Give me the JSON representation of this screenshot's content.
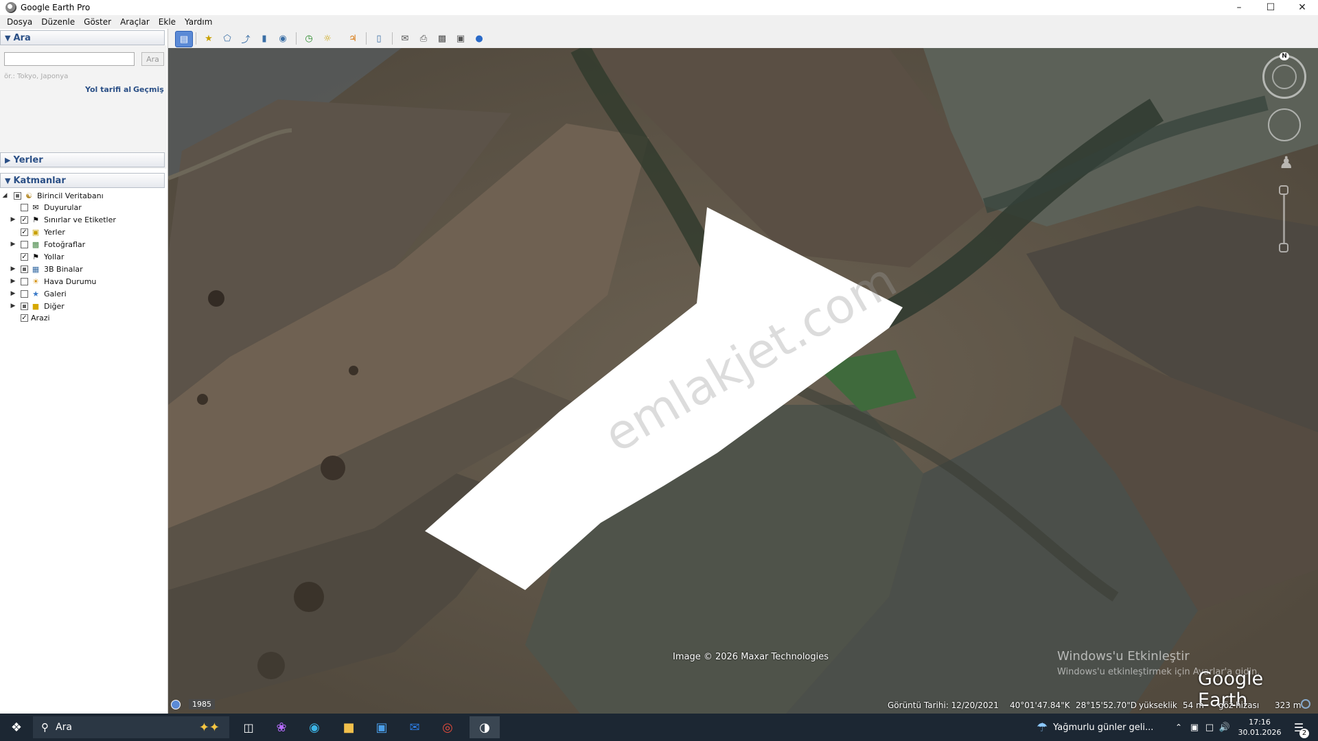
{
  "window": {
    "title": "Google Earth Pro"
  },
  "menu": [
    "Dosya",
    "Düzenle",
    "Göster",
    "Araçlar",
    "Ekle",
    "Yardım"
  ],
  "search": {
    "header": "Ara",
    "placeholder": "",
    "button": "Ara",
    "hint": "ör.: Tokyo, Japonya",
    "directions_link": "Yol tarifi al",
    "history_link": "Geçmiş"
  },
  "places": {
    "header": "Yerler"
  },
  "layers": {
    "header": "Katmanlar",
    "items": [
      {
        "label": "Birincil Veritabanı",
        "state": "partial",
        "icon": "database-icon"
      },
      {
        "label": "Duyurular",
        "state": "unchecked",
        "icon": "envelope-icon"
      },
      {
        "label": "Sınırlar ve Etiketler",
        "state": "checked",
        "icon": "flag-icon"
      },
      {
        "label": "Yerler",
        "state": "checked",
        "icon": "places-icon"
      },
      {
        "label": "Fotoğraflar",
        "state": "unchecked",
        "icon": "photo-icon"
      },
      {
        "label": "Yollar",
        "state": "checked",
        "icon": "road-icon"
      },
      {
        "label": "3B Binalar",
        "state": "partial",
        "icon": "building-icon"
      },
      {
        "label": "Hava Durumu",
        "state": "unchecked",
        "icon": "sun-icon"
      },
      {
        "label": "Galeri",
        "state": "unchecked",
        "icon": "star-icon"
      },
      {
        "label": "Diğer",
        "state": "partial",
        "icon": "folder-icon"
      },
      {
        "label": "Arazi",
        "state": "checked",
        "icon": ""
      }
    ]
  },
  "map": {
    "copyright": "Image © 2026 Maxar Technologies",
    "watermark": "emlakjet.com",
    "activation_title": "Windows'u Etkinleştir",
    "activation_sub": "Windows'u etkinleştirmek için Ayarlar'a gidin.",
    "logo": "Google Earth",
    "compass_label": "N",
    "year": "1985"
  },
  "status": {
    "date": "Görüntü Tarihi: 12/20/2021",
    "lat": "40°01'47.84\"K",
    "lon": "28°15'52.70\"D",
    "elev_label": "yükseklik",
    "elev": "54 m",
    "eye_label": "göz hizası",
    "eye": "323 m"
  },
  "taskbar": {
    "search": "Ara",
    "weather": "Yağmurlu günler geli...",
    "time": "17:16",
    "date": "30.01.2026",
    "notifications": "2"
  },
  "colors": {
    "accent": "#2a4f86",
    "taskbar": "#1c2733"
  }
}
